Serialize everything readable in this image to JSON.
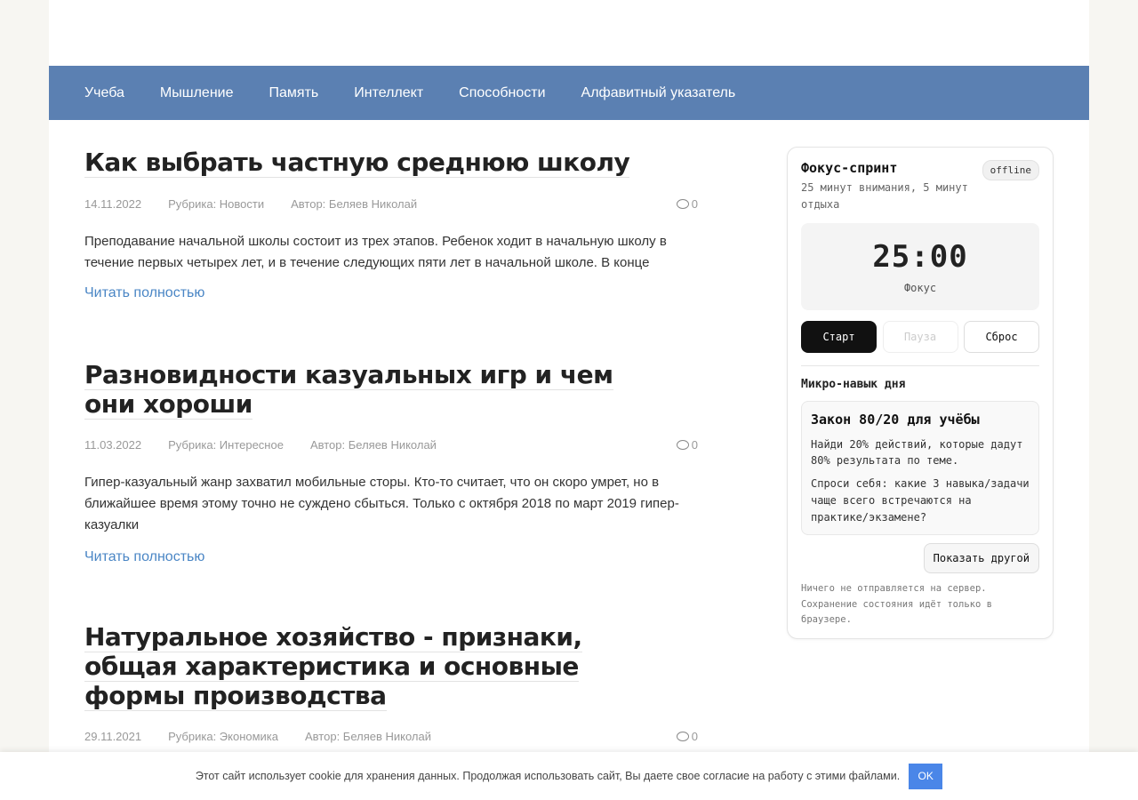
{
  "nav": {
    "items": [
      "Учеба",
      "Мышление",
      "Память",
      "Интеллект",
      "Способности",
      "Алфавитный указатель"
    ]
  },
  "posts": [
    {
      "title": "Как выбрать частную среднюю школу",
      "date": "14.11.2022",
      "category": "Рубрика: Новости",
      "author": "Автор: Беляев Николай",
      "comments": "0",
      "excerpt": "Преподавание начальной школы состоит из трех этапов. Ребенок ходит в начальную школу в течение первых четырех лет, и в течение следующих пяти лет в начальной школе. В конце",
      "read_more": "Читать полностью"
    },
    {
      "title": "Разновидности казуальных игр и чем они хороши",
      "date": "11.03.2022",
      "category": "Рубрика: Интересное",
      "author": "Автор: Беляев Николай",
      "comments": "0",
      "excerpt": "Гипер-казуальный жанр захватил мобильные сторы. Кто-то считает, что он скоро умрет, но в ближайшее время этому точно не суждено сбыться. Только с октября 2018 по март 2019 гипер-казуалки",
      "read_more": "Читать полностью"
    },
    {
      "title": "Натуральное хозяйство - признаки, общая характеристика и основные формы производства",
      "date": "29.11.2021",
      "category": "Рубрика: Экономика",
      "author": "Автор: Беляев Николай",
      "comments": "0"
    }
  ],
  "widget": {
    "title": "Фокус-спринт",
    "badge": "offline",
    "subtitle": "25 минут внимания, 5 минут отдыха",
    "timer": "25:00",
    "timer_label": "Фокус",
    "btn_start": "Старт",
    "btn_pause": "Пауза",
    "btn_reset": "Сброс",
    "skill_heading": "Микро-навык дня",
    "skill_title": "Закон 80/20 для учёбы",
    "skill_desc": "Найди 20% действий, которые дадут 80% результата по теме.",
    "skill_question": "Спроси себя: какие 3 навыка/задачи чаще всего встречаются на практике/экзамене?",
    "btn_another": "Показать другой",
    "note": "Ничего не отправляется на сервер. Сохранение состояния идёт только в браузере."
  },
  "cookie": {
    "text": "Этот сайт использует cookie для хранения данных. Продолжая использовать сайт, Вы даете свое согласие на работу с этими файлами.",
    "ok": "OK"
  }
}
